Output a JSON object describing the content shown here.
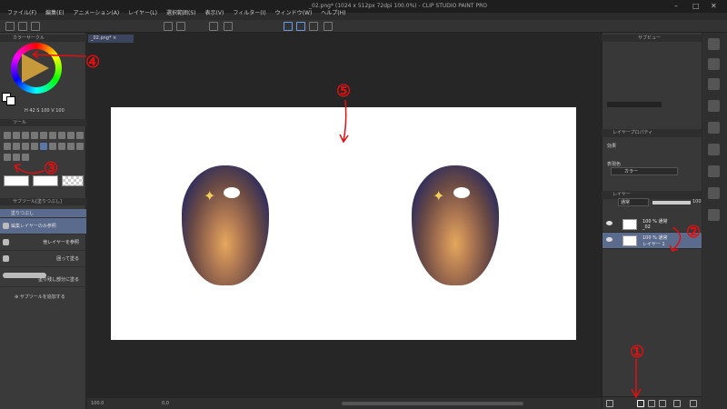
{
  "window": {
    "title": "_02.png* (1024 x 512px 72dpi 100.0%) - CLIP STUDIO PAINT PRO",
    "minimize": "–",
    "maximize": "□",
    "close": "✕"
  },
  "menu": [
    "ファイル(F)",
    "編集(E)",
    "アニメーション(A)",
    "レイヤー(L)",
    "選択範囲(S)",
    "表示(V)",
    "フィルター(I)",
    "ウィンドウ(W)",
    "ヘルプ(H)"
  ],
  "left_panel": {
    "color_header": "カラーサークル",
    "hsv_readout": "H 42  S 100  V 100",
    "tool_header": "ツール",
    "subtool_header": "サブツール[塗りつぶし]",
    "subtools": [
      {
        "label": "塗りつぶし",
        "selected": true
      },
      {
        "label": "編集レイヤーのみ参照",
        "selected": true
      },
      {
        "label": "他レイヤーを参照",
        "selected": false
      },
      {
        "label": "囲って塗る",
        "selected": false
      },
      {
        "label": "塗り残し部分に塗る",
        "selected": false
      }
    ],
    "add_subtool": "サブツールを追加する"
  },
  "canvas": {
    "tab_label": "_02.png*"
  },
  "right_panel": {
    "navigator_header": "サブビュー",
    "layer_property_header": "レイヤープロパティ",
    "effect_label": "効果",
    "expression_color_label": "表現色",
    "expression_color_value": "カラー",
    "layer_header": "レイヤー",
    "blend_mode": "通常",
    "opacity": "100",
    "layers": [
      {
        "mode": "100 % 通常",
        "name": "_02",
        "selected": false
      },
      {
        "mode": "100 % 通常",
        "name": "レイヤー 1",
        "selected": true
      }
    ]
  },
  "statusbar": {
    "zoom": "100.0",
    "angle": "0.0"
  },
  "annotations": [
    "①",
    "②",
    "③",
    "④",
    "⑤"
  ],
  "colors": {
    "accent": "#5b6b8e",
    "annotation": "#e01010",
    "current_color": "#c69a3a"
  }
}
